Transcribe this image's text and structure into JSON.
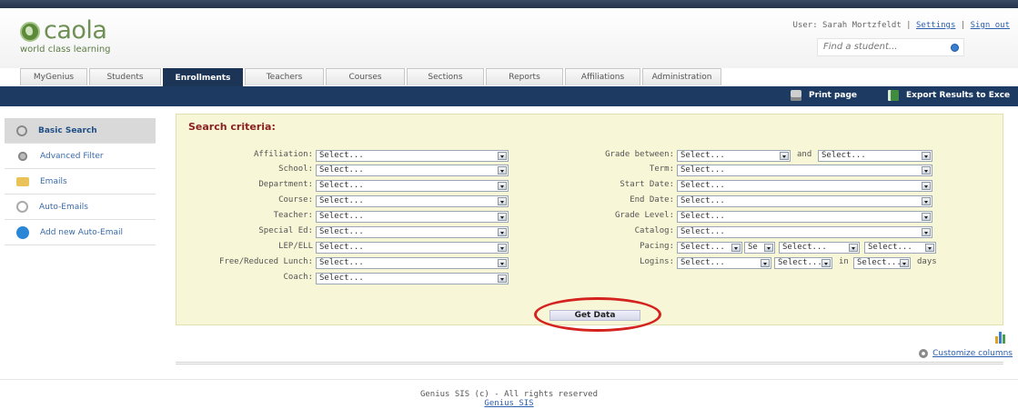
{
  "brand": {
    "name": "caola",
    "tagline": "world class learning"
  },
  "user": {
    "prefix": "User: Sarah Mortzfeldt |",
    "settings": "Settings",
    "sep": "|",
    "signout": "Sign out"
  },
  "search": {
    "placeholder": "Find a student..."
  },
  "tabs": [
    {
      "label": "MyGenius"
    },
    {
      "label": "Students"
    },
    {
      "label": "Enrollments",
      "active": true
    },
    {
      "label": "Teachers"
    },
    {
      "label": "Courses"
    },
    {
      "label": "Sections"
    },
    {
      "label": "Reports"
    },
    {
      "label": "Affiliations"
    },
    {
      "label": "Administration"
    }
  ],
  "navbar": {
    "print": "Print page",
    "export": "Export Results to Exce"
  },
  "sidebar": [
    {
      "label": "Basic Search",
      "icon": "magnifier-icon",
      "active": true
    },
    {
      "label": "Advanced Filter",
      "icon": "gears-icon"
    },
    {
      "label": "Emails",
      "icon": "envelope-icon"
    },
    {
      "label": "Auto-Emails",
      "icon": "clock-icon"
    },
    {
      "label": "Add new Auto-Email",
      "icon": "add-icon"
    }
  ],
  "panel": {
    "title": "Search criteria:",
    "left": [
      {
        "label": "Affiliation:",
        "value": "Select..."
      },
      {
        "label": "School:",
        "value": "Select..."
      },
      {
        "label": "Department:",
        "value": "Select..."
      },
      {
        "label": "Course:",
        "value": "Select..."
      },
      {
        "label": "Teacher:",
        "value": "Select..."
      },
      {
        "label": "Special Ed:",
        "value": "Select..."
      },
      {
        "label": "LEP/ELL",
        "value": "Select..."
      },
      {
        "label": "Free/Reduced Lunch:",
        "value": "Select..."
      },
      {
        "label": "Coach:",
        "value": "Select..."
      }
    ],
    "right": {
      "grade_between": {
        "label": "Grade between:",
        "from": "Select...",
        "and": "and",
        "to": "Select..."
      },
      "term": {
        "label": "Term:",
        "value": "Select..."
      },
      "start_date": {
        "label": "Start Date:",
        "value": "Select..."
      },
      "end_date": {
        "label": "End Date:",
        "value": "Select..."
      },
      "grade_level": {
        "label": "Grade Level:",
        "value": "Select..."
      },
      "catalog": {
        "label": "Catalog:",
        "value": "Select..."
      },
      "pacing": {
        "label": "Pacing:",
        "a": "Select...",
        "b": "Se",
        "c": "Select...",
        "d": "Select..."
      },
      "logins": {
        "label": "Logins:",
        "a": "Select...",
        "b": "Select...",
        "in": "in",
        "c": "Select...",
        "days": "days"
      }
    },
    "get_data": "Get Data"
  },
  "customize": "Customize columns",
  "footer": {
    "text": "Genius SIS (c) - All rights reserved",
    "link": "Genius SIS"
  },
  "colors": {
    "navy": "#1d3b62",
    "panel": "#f7f6d6",
    "title": "#8a1f1f",
    "highlight_ring": "#d4221e"
  }
}
